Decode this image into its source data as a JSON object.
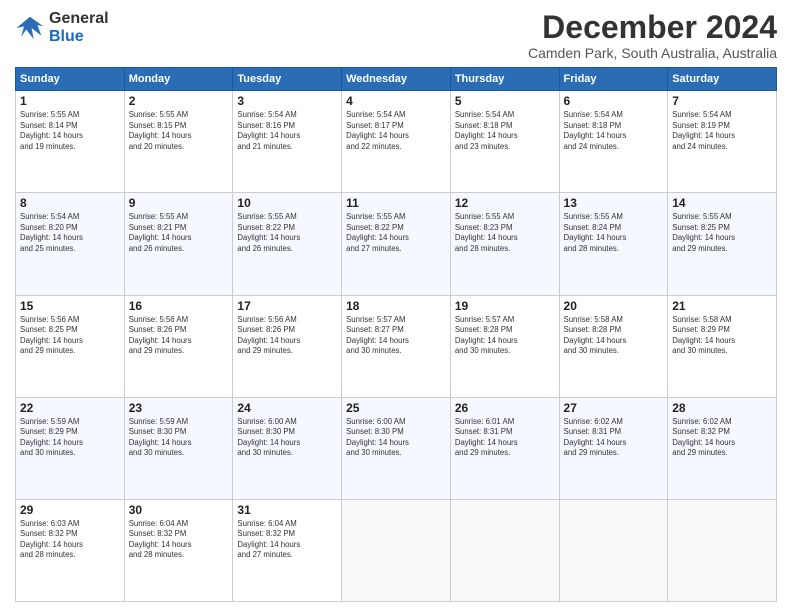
{
  "logo": {
    "general": "General",
    "blue": "Blue"
  },
  "header": {
    "month": "December 2024",
    "location": "Camden Park, South Australia, Australia"
  },
  "weekdays": [
    "Sunday",
    "Monday",
    "Tuesday",
    "Wednesday",
    "Thursday",
    "Friday",
    "Saturday"
  ],
  "weeks": [
    [
      {
        "day": 1,
        "sunrise": "5:55 AM",
        "sunset": "8:14 PM",
        "daylight": "14 hours and 19 minutes."
      },
      {
        "day": 2,
        "sunrise": "5:55 AM",
        "sunset": "8:15 PM",
        "daylight": "14 hours and 20 minutes."
      },
      {
        "day": 3,
        "sunrise": "5:54 AM",
        "sunset": "8:16 PM",
        "daylight": "14 hours and 21 minutes."
      },
      {
        "day": 4,
        "sunrise": "5:54 AM",
        "sunset": "8:17 PM",
        "daylight": "14 hours and 22 minutes."
      },
      {
        "day": 5,
        "sunrise": "5:54 AM",
        "sunset": "8:18 PM",
        "daylight": "14 hours and 23 minutes."
      },
      {
        "day": 6,
        "sunrise": "5:54 AM",
        "sunset": "8:18 PM",
        "daylight": "14 hours and 24 minutes."
      },
      {
        "day": 7,
        "sunrise": "5:54 AM",
        "sunset": "8:19 PM",
        "daylight": "14 hours and 24 minutes."
      }
    ],
    [
      {
        "day": 8,
        "sunrise": "5:54 AM",
        "sunset": "8:20 PM",
        "daylight": "14 hours and 25 minutes."
      },
      {
        "day": 9,
        "sunrise": "5:55 AM",
        "sunset": "8:21 PM",
        "daylight": "14 hours and 26 minutes."
      },
      {
        "day": 10,
        "sunrise": "5:55 AM",
        "sunset": "8:22 PM",
        "daylight": "14 hours and 26 minutes."
      },
      {
        "day": 11,
        "sunrise": "5:55 AM",
        "sunset": "8:22 PM",
        "daylight": "14 hours and 27 minutes."
      },
      {
        "day": 12,
        "sunrise": "5:55 AM",
        "sunset": "8:23 PM",
        "daylight": "14 hours and 28 minutes."
      },
      {
        "day": 13,
        "sunrise": "5:55 AM",
        "sunset": "8:24 PM",
        "daylight": "14 hours and 28 minutes."
      },
      {
        "day": 14,
        "sunrise": "5:55 AM",
        "sunset": "8:25 PM",
        "daylight": "14 hours and 29 minutes."
      }
    ],
    [
      {
        "day": 15,
        "sunrise": "5:56 AM",
        "sunset": "8:25 PM",
        "daylight": "14 hours and 29 minutes."
      },
      {
        "day": 16,
        "sunrise": "5:56 AM",
        "sunset": "8:26 PM",
        "daylight": "14 hours and 29 minutes."
      },
      {
        "day": 17,
        "sunrise": "5:56 AM",
        "sunset": "8:26 PM",
        "daylight": "14 hours and 29 minutes."
      },
      {
        "day": 18,
        "sunrise": "5:57 AM",
        "sunset": "8:27 PM",
        "daylight": "14 hours and 30 minutes."
      },
      {
        "day": 19,
        "sunrise": "5:57 AM",
        "sunset": "8:28 PM",
        "daylight": "14 hours and 30 minutes."
      },
      {
        "day": 20,
        "sunrise": "5:58 AM",
        "sunset": "8:28 PM",
        "daylight": "14 hours and 30 minutes."
      },
      {
        "day": 21,
        "sunrise": "5:58 AM",
        "sunset": "8:29 PM",
        "daylight": "14 hours and 30 minutes."
      }
    ],
    [
      {
        "day": 22,
        "sunrise": "5:59 AM",
        "sunset": "8:29 PM",
        "daylight": "14 hours and 30 minutes."
      },
      {
        "day": 23,
        "sunrise": "5:59 AM",
        "sunset": "8:30 PM",
        "daylight": "14 hours and 30 minutes."
      },
      {
        "day": 24,
        "sunrise": "6:00 AM",
        "sunset": "8:30 PM",
        "daylight": "14 hours and 30 minutes."
      },
      {
        "day": 25,
        "sunrise": "6:00 AM",
        "sunset": "8:30 PM",
        "daylight": "14 hours and 30 minutes."
      },
      {
        "day": 26,
        "sunrise": "6:01 AM",
        "sunset": "8:31 PM",
        "daylight": "14 hours and 29 minutes."
      },
      {
        "day": 27,
        "sunrise": "6:02 AM",
        "sunset": "8:31 PM",
        "daylight": "14 hours and 29 minutes."
      },
      {
        "day": 28,
        "sunrise": "6:02 AM",
        "sunset": "8:32 PM",
        "daylight": "14 hours and 29 minutes."
      }
    ],
    [
      {
        "day": 29,
        "sunrise": "6:03 AM",
        "sunset": "8:32 PM",
        "daylight": "14 hours and 28 minutes."
      },
      {
        "day": 30,
        "sunrise": "6:04 AM",
        "sunset": "8:32 PM",
        "daylight": "14 hours and 28 minutes."
      },
      {
        "day": 31,
        "sunrise": "6:04 AM",
        "sunset": "8:32 PM",
        "daylight": "14 hours and 27 minutes."
      },
      null,
      null,
      null,
      null
    ]
  ]
}
